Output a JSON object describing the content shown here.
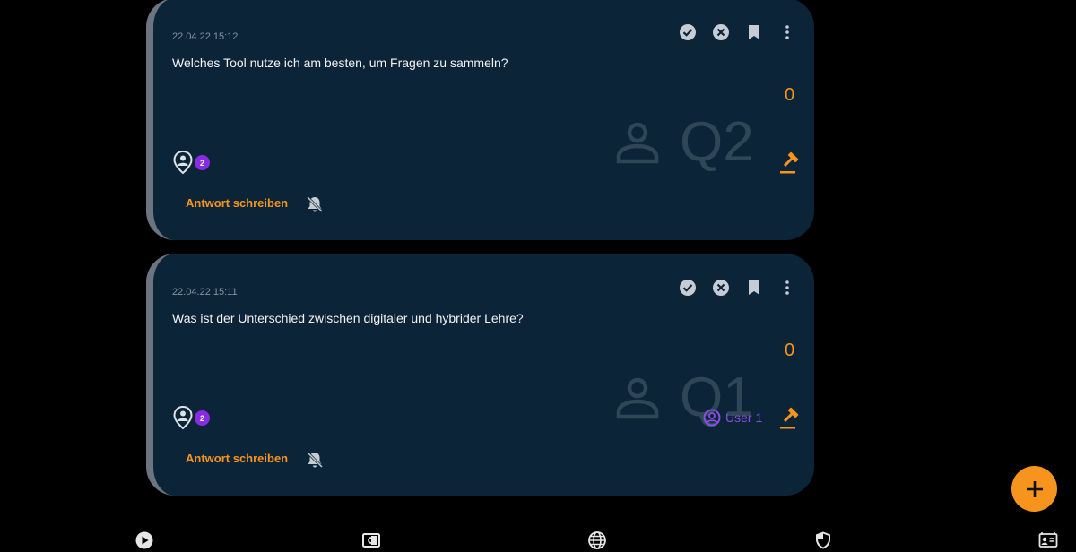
{
  "questions": [
    {
      "timestamp": "22.04.22 15:12",
      "text": "Welches Tool nutze ich am besten, um Fragen zu sammeln?",
      "score": "0",
      "number": "Q2",
      "badge_count": "2",
      "reply_label": "Antwort schreiben",
      "user": null
    },
    {
      "timestamp": "22.04.22 15:11",
      "text": "Was ist der Unterschied zwischen digitaler und hybrider Lehre?",
      "score": "0",
      "number": "Q1",
      "badge_count": "2",
      "reply_label": "Antwort schreiben",
      "user": "User 1"
    }
  ],
  "icons": {
    "card_actions": [
      "check-circle-icon",
      "cancel-circle-icon",
      "bookmark-icon",
      "more-vertical-icon"
    ],
    "bottom_nav": [
      "play-circle-icon",
      "presentation-icon",
      "globe-icon",
      "shield-icon",
      "contact-card-icon"
    ],
    "fab": "plus-icon"
  },
  "colors": {
    "background": "#000000",
    "card": "#0b2438",
    "card_border": "#6c7480",
    "accent": "#f7941d",
    "badge": "#8a2be2",
    "user": "#8a4fe0",
    "icon": "#c5ccd3",
    "watermark": "#2f4657"
  }
}
